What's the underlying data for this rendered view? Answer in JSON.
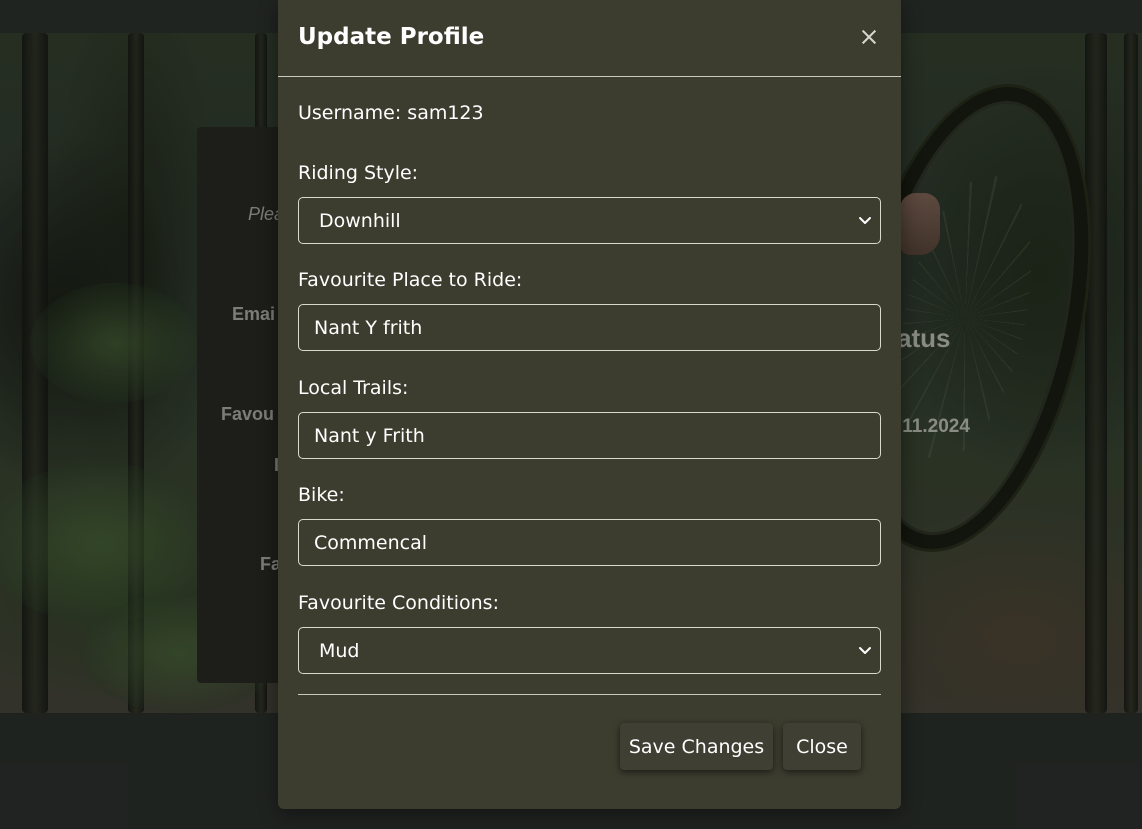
{
  "background_page": {
    "card_labels": [
      "Plea",
      "Emai",
      "Favou",
      "I",
      "Fa"
    ],
    "status_fragment": "atus",
    "date_fragment": ".11.2024"
  },
  "modal": {
    "title": "Update Profile",
    "close_icon": "close-icon",
    "username_text": "Username: sam123",
    "fields": {
      "riding_style": {
        "label": "Riding Style:",
        "value": "Downhill"
      },
      "favourite_place": {
        "label": "Favourite Place to Ride:",
        "value": "Nant Y frith"
      },
      "local_trails": {
        "label": "Local Trails:",
        "value": "Nant y Frith"
      },
      "bike": {
        "label": "Bike:",
        "value": "Commencal"
      },
      "favourite_conditions": {
        "label": "Favourite Conditions:",
        "value": "Mud"
      }
    },
    "buttons": {
      "save": "Save Changes",
      "close": "Close"
    }
  },
  "colors": {
    "modal_background": "#3c3c2f",
    "page_background": "#222623",
    "border": "#d9d9cf"
  }
}
